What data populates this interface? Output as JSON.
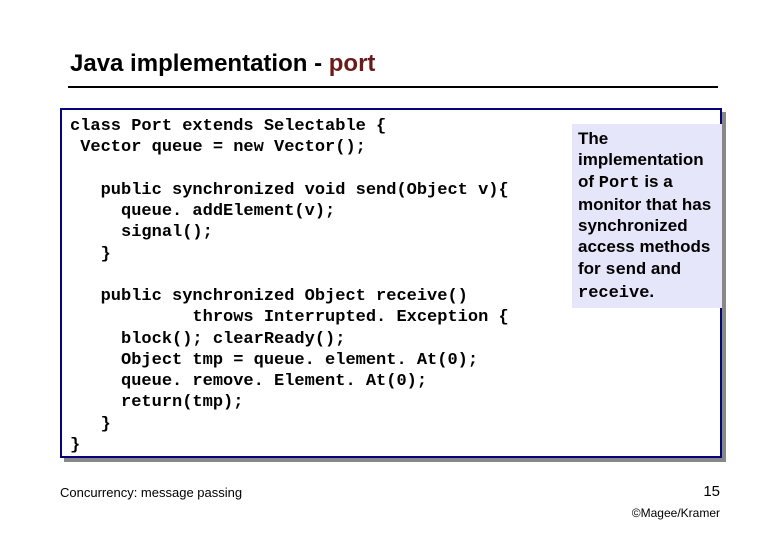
{
  "title": {
    "prefix": "Java implementation - ",
    "port": "port"
  },
  "code": {
    "line1": "class Port extends Selectable {",
    "line2": " Vector queue = new Vector();",
    "line3": "",
    "line4": "   public synchronized void send(Object v){",
    "line5": "     queue. addElement(v);",
    "line6": "     signal();",
    "line7": "   }",
    "line8": "",
    "line9": "   public synchronized Object receive()",
    "line10": "            throws Interrupted. Exception {",
    "line11": "     block(); clearReady();",
    "line12": "     Object tmp = queue. element. At(0);",
    "line13": "     queue. remove. Element. At(0);",
    "line14": "     return(tmp);",
    "line15": "   }",
    "line16": "}"
  },
  "note": {
    "t1": "The implementation of ",
    "port": "Port",
    "t2": " is a monitor that has synchronized access methods for ",
    "send": "send",
    "t3": " and ",
    "receive": "receive",
    "t4": "."
  },
  "footer": {
    "left": "Concurrency: message passing",
    "page": "15",
    "credit": "©Magee/Kramer"
  }
}
